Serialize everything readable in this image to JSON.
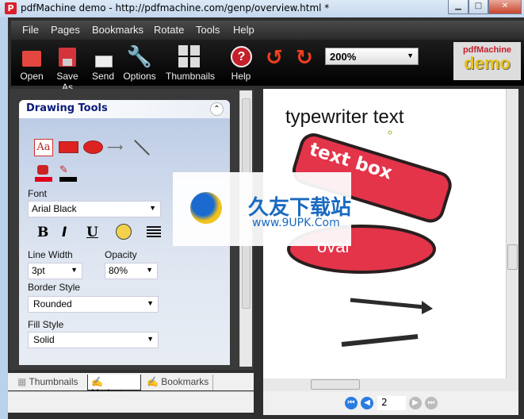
{
  "window": {
    "title": "pdfMachine demo - http://pdfmachine.com/genp/overview.html *",
    "app_icon": "P"
  },
  "menu": [
    "File",
    "Pages",
    "Bookmarks",
    "Rotate",
    "Tools",
    "Help"
  ],
  "toolbar": {
    "open": "Open",
    "save_as": "Save As",
    "send": "Send",
    "options": "Options",
    "thumbnails": "Thumbnails",
    "help": "Help",
    "zoom": "200%"
  },
  "logo": {
    "line1": "pdfMachine",
    "line2": "demo"
  },
  "drawing_tools": {
    "title": "Drawing Tools",
    "font_label": "Font",
    "font": "Arial Black",
    "line_width_label": "Line Width",
    "line_width": "3pt",
    "opacity_label": "Opacity",
    "opacity": "80%",
    "border_style_label": "Border Style",
    "border_style": "Rounded",
    "fill_style_label": "Fill Style",
    "fill_style": "Solid",
    "text_tool": "Aa",
    "bold": "B",
    "italic": "I",
    "underline": "U"
  },
  "tabs": [
    {
      "label": "Thumbnails"
    },
    {
      "label": "Markup",
      "active": true
    },
    {
      "label": "Bookmarks"
    }
  ],
  "document": {
    "typewriter": "typewriter text",
    "textbox": "text box",
    "oval": "oval",
    "fill_color": "#e3344a"
  },
  "pager": {
    "page": "2"
  },
  "watermark": {
    "brand": "久友下载站",
    "url": "www.9UPK.Com"
  }
}
